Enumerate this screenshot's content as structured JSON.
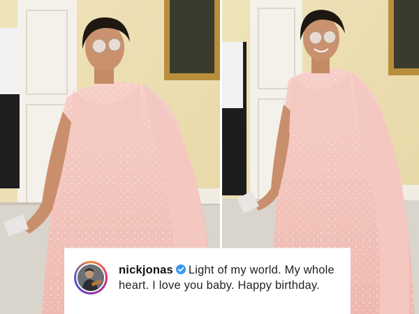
{
  "post": {
    "username": "nickjonas",
    "verified_icon": "verified-badge-icon",
    "caption": "Light of my world. My whole heart. I love you baby. Happy birthday."
  },
  "photos": [
    {
      "description_icon": "photo-left"
    },
    {
      "description_icon": "photo-right"
    }
  ],
  "colors": {
    "verified_blue": "#3897f0",
    "wall": "#efe2b6",
    "saree": "#f2c3bd"
  }
}
